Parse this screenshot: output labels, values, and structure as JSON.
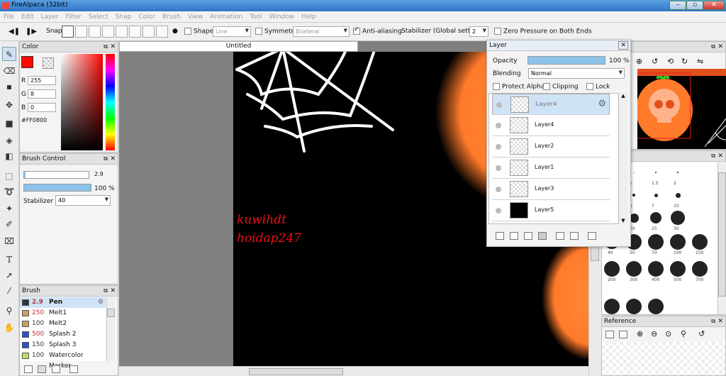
{
  "window": {
    "title": "FireAlpaca (32bit)"
  },
  "menu": [
    "File",
    "Edit",
    "Layer",
    "Filter",
    "Select",
    "Snap",
    "Color",
    "Brush",
    "View",
    "Animation",
    "Tool",
    "Window",
    "Help"
  ],
  "toolbar": {
    "snap_label": "Snap",
    "shape_label": "Shape",
    "shape_value": "Line",
    "symmetry_label": "Symmetry",
    "symmetry_value": "Bilateral",
    "antialias_label": "Anti-aliasing",
    "stabilizer_label": "Stabilizer (Global settings)",
    "stabilizer_value": "2",
    "zero_pressure_label": "Zero Pressure on Both Ends"
  },
  "color_panel": {
    "title": "Color",
    "r_label": "R",
    "r": "255",
    "g_label": "G",
    "g": "8",
    "b_label": "B",
    "b": "0",
    "hex": "#FF0800",
    "fg_color": "#ff0800"
  },
  "brush_control": {
    "title": "Brush Control",
    "size": "2.9",
    "opacity": "100 %",
    "stabilizer_label": "Stabilizer",
    "stabilizer_value": "40"
  },
  "brush_panel": {
    "title": "Brush",
    "items": [
      {
        "size": "2.9",
        "name": "Pen",
        "color": "#333333"
      },
      {
        "size": "250",
        "name": "Melt1",
        "color": "#c8a060"
      },
      {
        "size": "100",
        "name": "Melt2",
        "color": "#c8a060"
      },
      {
        "size": "500",
        "name": "Splash 2",
        "color": "#3050d0"
      },
      {
        "size": "150",
        "name": "Splash 3",
        "color": "#3050d0"
      },
      {
        "size": "100",
        "name": "Watercolor Marker",
        "color": "#b8e060"
      }
    ]
  },
  "canvas": {
    "tab_title": "Untitled",
    "signature_line1": "kuwihdt",
    "signature_line2": "hoidap247"
  },
  "layer_panel": {
    "title": "Layer",
    "opacity_label": "Opacity",
    "opacity_value": "100 %",
    "blending_label": "Blending",
    "blending_value": "Normal",
    "protect_alpha": "Protect Alpha",
    "clipping": "Clipping",
    "lock": "Lock",
    "layers": [
      "Layer4",
      "Layer4",
      "Layer2",
      "Layer1",
      "Layer3",
      "Layer5"
    ]
  },
  "brush_sizes": {
    "labels_row1": [
      "7",
      "1",
      "1.5",
      "2"
    ],
    "labels_row2": [
      "4",
      "5",
      "7",
      "10"
    ],
    "labels_row3": [
      "15",
      "20",
      "25",
      "30"
    ],
    "labels_row4": [
      "40",
      "50",
      "70",
      "100",
      "150"
    ],
    "labels_row5": [
      "200",
      "300",
      "400",
      "500",
      "700"
    ]
  },
  "reference_panel": {
    "title": "Reference"
  }
}
